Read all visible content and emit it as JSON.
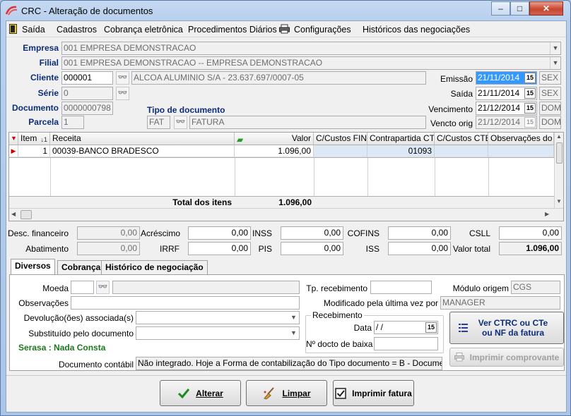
{
  "window": {
    "title": "CRC - Alteração de documentos",
    "min": "–",
    "max": "□",
    "close": "✕"
  },
  "menu": {
    "saida": "Saída",
    "cadastros": "Cadastros",
    "cobranca": "Cobrança eletrônica",
    "procedimentos": "Procedimentos Diários",
    "configuracoes": "Configurações",
    "historicos": "Históricos das negociações"
  },
  "header": {
    "empresa_label": "Empresa",
    "empresa_value": "001 EMPRESA DEMONSTRACAO",
    "filial_label": "Filial",
    "filial_value": "001 EMPRESA DEMONSTRACAO -- EMPRESA DEMONSTRACAO",
    "cliente_label": "Cliente",
    "cliente_code": "000001",
    "cliente_name": "ALCOA ALUMINIO S/A - 23.637.697/0007-05",
    "serie_label": "Série",
    "serie_value": "0",
    "documento_label": "Documento",
    "documento_value": "0000000798",
    "parcela_label": "Parcela",
    "parcela_value": "1",
    "tipo_label": "Tipo de documento",
    "tipo_code": "FAT",
    "tipo_name": "FATURA",
    "emissao_label": "Emissão",
    "emissao_value": "21/11/2014",
    "emissao_dow": "SEX",
    "saida_label": "Saída",
    "saida_value": "21/11/2014",
    "saida_dow": "SEX",
    "vencimento_label": "Vencimento",
    "vencimento_value": "21/12/2014",
    "vencimento_dow": "DOM",
    "vencto_label": "Vencto orig",
    "vencto_value": "21/12/2014",
    "vencto_dow": "DOM",
    "cal_glyph": "15"
  },
  "grid": {
    "columns": [
      "Item",
      "Receita",
      "Valor",
      "C/Custos FIN",
      "Contrapartida CTB",
      "C/Custos CTB",
      "Observações do ite"
    ],
    "rows": [
      {
        "item": "1",
        "receita": "00039-BANCO BRADESCO",
        "valor": "1.096,00",
        "ccfin": "",
        "contrapartida": "01093",
        "ccctb": "",
        "obs": ""
      }
    ],
    "total_label": "Total dos itens",
    "total_value": "1.096,00"
  },
  "totals": {
    "desc_label": "Desc. financeiro",
    "desc_value": "0,00",
    "acrescimo_label": "Acréscimo",
    "acrescimo_value": "0,00",
    "inss_label": "INSS",
    "inss_value": "0,00",
    "cofins_label": "COFINS",
    "cofins_value": "0,00",
    "csll_label": "CSLL",
    "csll_value": "0,00",
    "abatimento_label": "Abatimento",
    "abatimento_value": "0,00",
    "irrf_label": "IRRF",
    "irrf_value": "0,00",
    "pis_label": "PIS",
    "pis_value": "0,00",
    "iss_label": "ISS",
    "iss_value": "0,00",
    "valortotal_label": "Valor total",
    "valortotal_value": "1.096,00"
  },
  "tabs": [
    "Diversos",
    "Cobrança",
    "Histórico de negociação"
  ],
  "diversos": {
    "moeda_label": "Moeda",
    "moeda_value": "",
    "obs_label": "Observações",
    "obs_value": "",
    "devolucao_label": "Devolução(ões) associada(s)",
    "devolucao_value": "",
    "substituido_label": "Substituído pelo documento",
    "substituido_value": "",
    "serasa": "Serasa : Nada Consta",
    "doccontabil_label": "Documento contábil",
    "doccontabil_value": "Não integrado. Hoje a Forma de contabilização do Tipo documento = B - Documento integr",
    "tprec_label": "Tp. recebimento",
    "tprec_value": "",
    "modulo_label": "Módulo origem",
    "modulo_value": "CGS",
    "modificado_label": "Modificado pela última vez por",
    "modificado_value": "MANAGER",
    "recebimento_group": "Recebimento",
    "data_label": "Data",
    "data_value": " /  /",
    "ndocto_label": "Nº docto de baixa",
    "ndocto_value": "",
    "ver_ctrc_label": "Ver CTRC ou CTe ou NF da fatura",
    "imprimir_comp_label": "Imprimir comprovante"
  },
  "footer": {
    "alterar": "Alterar",
    "limpar": "Limpar",
    "imprimir_fatura": "Imprimir fatura"
  },
  "colors": {
    "label_blue": "#0b2d7a",
    "serasa_green": "#1a7a1a",
    "selection": "#3399ff"
  }
}
